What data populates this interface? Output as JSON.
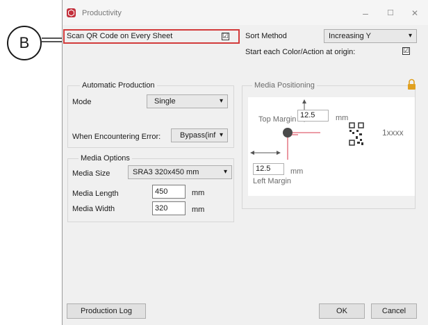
{
  "callout": {
    "letter": "B"
  },
  "window": {
    "title": "Productivity",
    "controls": {
      "minimize": "–",
      "maximize": "☐",
      "close": "✕"
    }
  },
  "scan_qr": {
    "label": "Scan QR Code on Every Sheet",
    "checked": true,
    "check_glyph": "☑"
  },
  "sort": {
    "label": "Sort Method",
    "value": "Increasing Y"
  },
  "start_each": {
    "label": "Start each Color/Action at origin:",
    "check_glyph": "☑"
  },
  "automatic_production": {
    "title": "Automatic Production",
    "mode_label": "Mode",
    "mode_value": "Single",
    "error_label": "When Encountering Error:",
    "error_value": "Bypass(inf"
  },
  "media_options": {
    "title": "Media Options",
    "size_label": "Media Size",
    "size_value": "SRA3 320x450 mm",
    "length_label": "Media Length",
    "length_value": "450",
    "length_unit": "mm",
    "width_label": "Media Width",
    "width_value": "320",
    "width_unit": "mm"
  },
  "media_positioning": {
    "title": "Media Positioning",
    "top_margin_label": "Top Margin",
    "top_margin_value": "12.5",
    "top_unit": "mm",
    "left_margin_label": "Left Margin",
    "left_margin_value": "12.5",
    "left_unit": "mm",
    "sample_text": "1xxxx"
  },
  "buttons": {
    "production_log": "Production Log",
    "ok": "OK",
    "cancel": "Cancel"
  },
  "colors": {
    "accent_red": "#d23a3a",
    "lock": "#e0a020"
  },
  "icons": {
    "caret": "▾",
    "lock": "lock-icon",
    "qr": "qr-code-icon"
  }
}
